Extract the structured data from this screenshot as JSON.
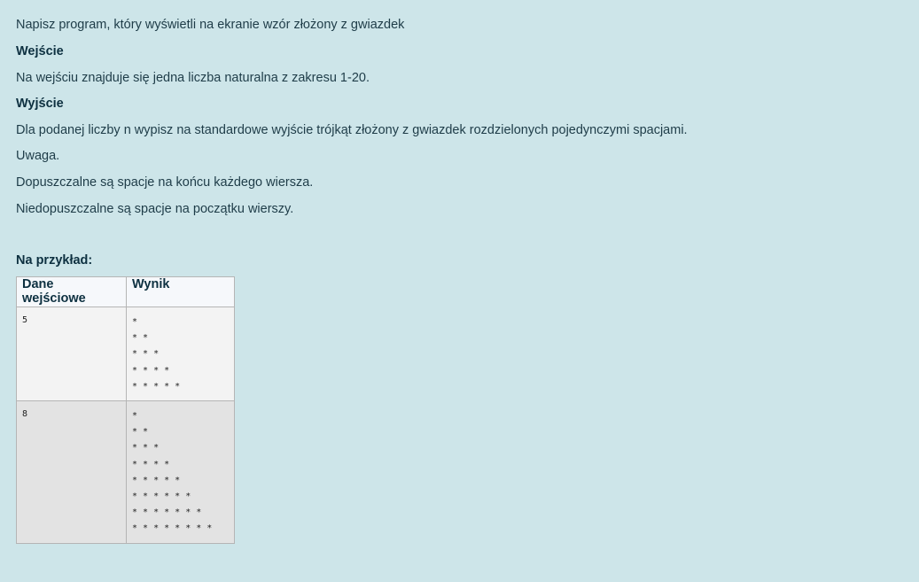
{
  "task": {
    "intro": "Napisz program, który wyświetli na ekranie wzór złożony z gwiazdek",
    "input_heading": "Wejście",
    "input_text": "Na wejściu znajduje się jedna liczba naturalna z zakresu 1-20.",
    "output_heading": "Wyjście",
    "output_text": "Dla podanej liczby n wypisz na standardowe wyjście trójkąt złożony z gwiazdek rozdzielonych pojedynczymi spacjami.",
    "note": "Uwaga.",
    "note_line1": "Dopuszczalne są spacje na końcu każdego wiersza.",
    "note_line2": "Niedopuszczalne są spacje na początku wierszy.",
    "example_heading": "Na przykład:"
  },
  "examples": {
    "headers": [
      "Dane wejściowe",
      "Wynik"
    ],
    "rows": [
      {
        "input": "5",
        "output": "*\n* *\n* * *\n* * * *\n* * * * *"
      },
      {
        "input": "8",
        "output": "*\n* *\n* * *\n* * * *\n* * * * *\n* * * * * *\n* * * * * * *\n* * * * * * * *"
      }
    ]
  }
}
